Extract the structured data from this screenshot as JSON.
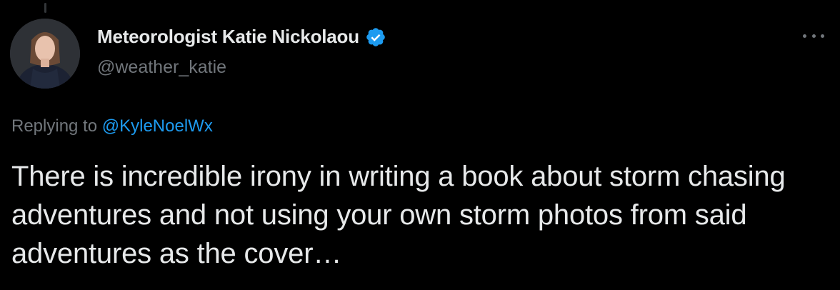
{
  "tweet": {
    "author": {
      "display_name": "Meteorologist Katie Nickolaou",
      "handle": "@weather_katie",
      "verified": true,
      "avatar_icon": "avatar-photo"
    },
    "more_icon": "more-options-icon",
    "reply": {
      "prefix": "Replying to",
      "mention": "@KyleNoelWx"
    },
    "text": "There is incredible irony in writing a book about storm chasing adventures and not using your own storm photos from said adventures as the cover…"
  },
  "colors": {
    "background": "#000000",
    "primary_text": "#e7e9ea",
    "secondary_text": "#71767b",
    "accent": "#1d9bf0"
  }
}
